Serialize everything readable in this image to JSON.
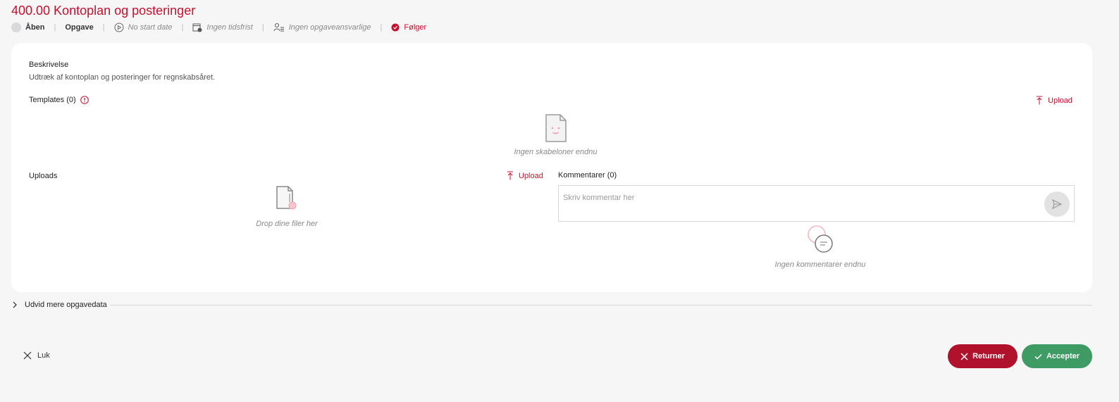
{
  "title": "400.00 Kontoplan og posteringer",
  "meta": {
    "status": "Åben",
    "type": "Opgave",
    "start_date": "No start date",
    "deadline": "Ingen tidsfrist",
    "responsible": "Ingen opgaveansvarlige",
    "follow": "Følger"
  },
  "card": {
    "description_label": "Beskrivelse",
    "description_text": "Udtræk af kontoplan og posteringer for regnskabsåret.",
    "templates_label": "Templates (0)",
    "templates_upload": "Upload",
    "templates_empty": "Ingen skabeloner endnu",
    "uploads_label": "Uploads",
    "uploads_upload": "Upload",
    "uploads_empty": "Drop dine filer her",
    "comments_label": "Kommentarer (0)",
    "comment_placeholder": "Skriv kommentar her",
    "comments_empty": "Ingen kommentarer endnu"
  },
  "expand_label": "Udvid mere opgavedata",
  "footer": {
    "close": "Luk",
    "return": "Returner",
    "accept": "Accepter"
  },
  "colors": {
    "accent": "#c8102e",
    "return_button": "#b0112b",
    "accept_button": "#3e9b63"
  }
}
